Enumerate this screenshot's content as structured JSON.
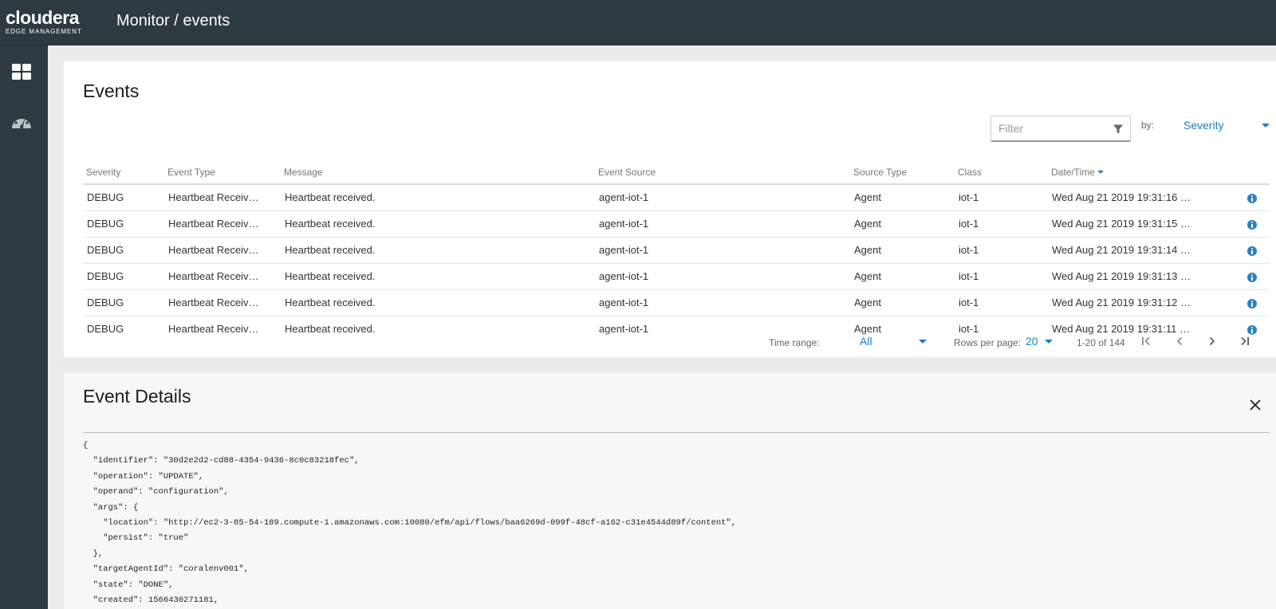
{
  "header": {
    "logo_main": "cloudera",
    "logo_sub": "EDGE MANAGEMENT",
    "title": "Monitor / events"
  },
  "sidebar": {
    "items": [
      {
        "icon": "dashboard-grid-icon"
      },
      {
        "icon": "speedometer-icon"
      }
    ]
  },
  "events": {
    "title": "Events",
    "filter": {
      "placeholder": "Filter",
      "value": ""
    },
    "by_label": "by:",
    "by_value": "Severity",
    "columns": [
      "Severity",
      "Event Type",
      "Message",
      "Event Source",
      "Source Type",
      "Class",
      "Date/Time"
    ],
    "rows": [
      [
        "DEBUG",
        "Heartbeat Receiv…",
        "Heartbeat received.",
        "agent-iot-1",
        "Agent",
        "iot-1",
        "Wed Aug 21 2019 19:31:16 …"
      ],
      [
        "DEBUG",
        "Heartbeat Receiv…",
        "Heartbeat received.",
        "agent-iot-1",
        "Agent",
        "iot-1",
        "Wed Aug 21 2019 19:31:15 …"
      ],
      [
        "DEBUG",
        "Heartbeat Receiv…",
        "Heartbeat received.",
        "agent-iot-1",
        "Agent",
        "iot-1",
        "Wed Aug 21 2019 19:31:14 …"
      ],
      [
        "DEBUG",
        "Heartbeat Receiv…",
        "Heartbeat received.",
        "agent-iot-1",
        "Agent",
        "iot-1",
        "Wed Aug 21 2019 19:31:13 …"
      ],
      [
        "DEBUG",
        "Heartbeat Receiv…",
        "Heartbeat received.",
        "agent-iot-1",
        "Agent",
        "iot-1",
        "Wed Aug 21 2019 19:31:12 …"
      ],
      [
        "DEBUG",
        "Heartbeat Receiv…",
        "Heartbeat received.",
        "agent-iot-1",
        "Agent",
        "iot-1",
        "Wed Aug 21 2019 19:31:11 …"
      ]
    ],
    "pagination": {
      "time_range_label": "Time range:",
      "time_range_value": "All",
      "rows_per_page_label": "Rows per page:",
      "rows_per_page_value": "20",
      "range_text": "1-20 of 144"
    }
  },
  "details": {
    "title": "Event Details",
    "json_lines": [
      "{",
      "  \"identifier\": \"30d2e2d2-cd88-4354-9436-8c0c83218fec\",",
      "  \"operation\": \"UPDATE\",",
      "  \"operand\": \"configuration\",",
      "  \"args\": {",
      "    \"location\": \"http://ec2-3-85-54-189.compute-1.amazonaws.com:10080/efm/api/flows/baa6269d-099f-48cf-a162-c31e4544d89f/content\",",
      "    \"persist\": \"true\"",
      "  },",
      "  \"targetAgentId\": \"coralenv001\",",
      "  \"state\": \"DONE\",",
      "  \"created\": 1566430271181,"
    ]
  },
  "colors": {
    "topbar": "#2d3a40",
    "accent": "#1a7dc4",
    "info": "#2b7fc8"
  }
}
